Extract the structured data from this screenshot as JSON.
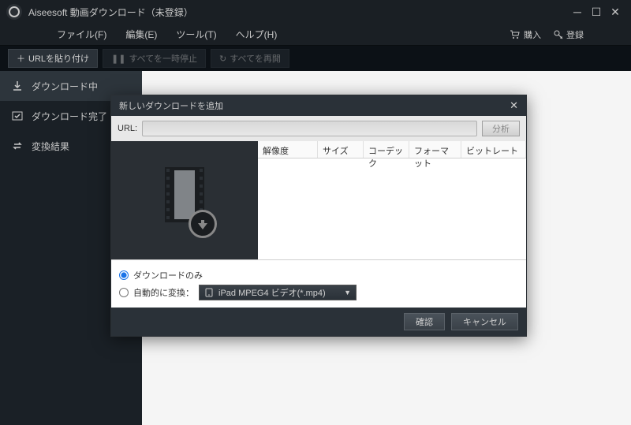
{
  "titlebar": {
    "app_name": "Aiseesoft 動画ダウンロード（未登録）"
  },
  "menu": {
    "file": "ファイル(F)",
    "edit": "編集(E)",
    "tools": "ツール(T)",
    "help": "ヘルプ(H)",
    "buy": "購入",
    "register": "登録"
  },
  "toolbar": {
    "paste_url": "URLを貼り付け",
    "pause_all": "すべてを一時停止",
    "resume_all": "すべてを再開"
  },
  "sidebar": {
    "items": [
      {
        "label": "ダウンロード中"
      },
      {
        "label": "ダウンロード完了"
      },
      {
        "label": "変換結果"
      }
    ]
  },
  "dialog": {
    "title": "新しいダウンロードを追加",
    "url_label": "URL:",
    "url_value": "",
    "analyze": "分析",
    "columns": {
      "resolution": "解像度",
      "size": "サイズ",
      "codec": "コーデック",
      "format": "フォーマット",
      "bitrate": "ビットレート"
    },
    "option_download_only": "ダウンロードのみ",
    "option_auto_convert": "自動的に変換：",
    "format_selected": "iPad MPEG4 ビデオ(*.mp4)",
    "ok": "確認",
    "cancel": "キャンセル"
  }
}
